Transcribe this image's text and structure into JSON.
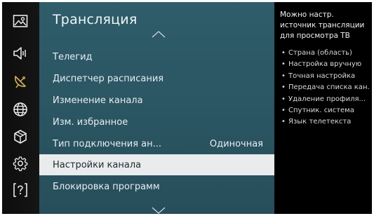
{
  "sidebar": {
    "items": [
      {
        "icon": "picture-icon"
      },
      {
        "icon": "sound-icon"
      },
      {
        "icon": "broadcast-icon",
        "active": true
      },
      {
        "icon": "network-icon"
      },
      {
        "icon": "system-icon"
      },
      {
        "icon": "settings-icon"
      },
      {
        "icon": "support-icon"
      }
    ],
    "active_color": "#d9b24c"
  },
  "panel": {
    "title": "Трансляция",
    "menu": [
      {
        "label": "Телегид",
        "value": ""
      },
      {
        "label": "Диспетчер расписания",
        "value": ""
      },
      {
        "label": "Изменение канала",
        "value": ""
      },
      {
        "label": "Изм. избранное",
        "value": ""
      },
      {
        "label": "Тип подключения ан...",
        "value": "Одиночная"
      },
      {
        "label": "Настройки канала",
        "value": "",
        "selected": true
      },
      {
        "label": "Блокировка программ",
        "value": ""
      }
    ],
    "bg_color": "#2c5865"
  },
  "info": {
    "description": "Можно настр. источник трансляции для просмотра ТВ",
    "items": [
      "Страна (область)",
      "Настройка вручную",
      "Точная настройка",
      "Передача списка кан.",
      "Удаление профиля...",
      "Спутник. система",
      "Язык телетекста"
    ]
  }
}
